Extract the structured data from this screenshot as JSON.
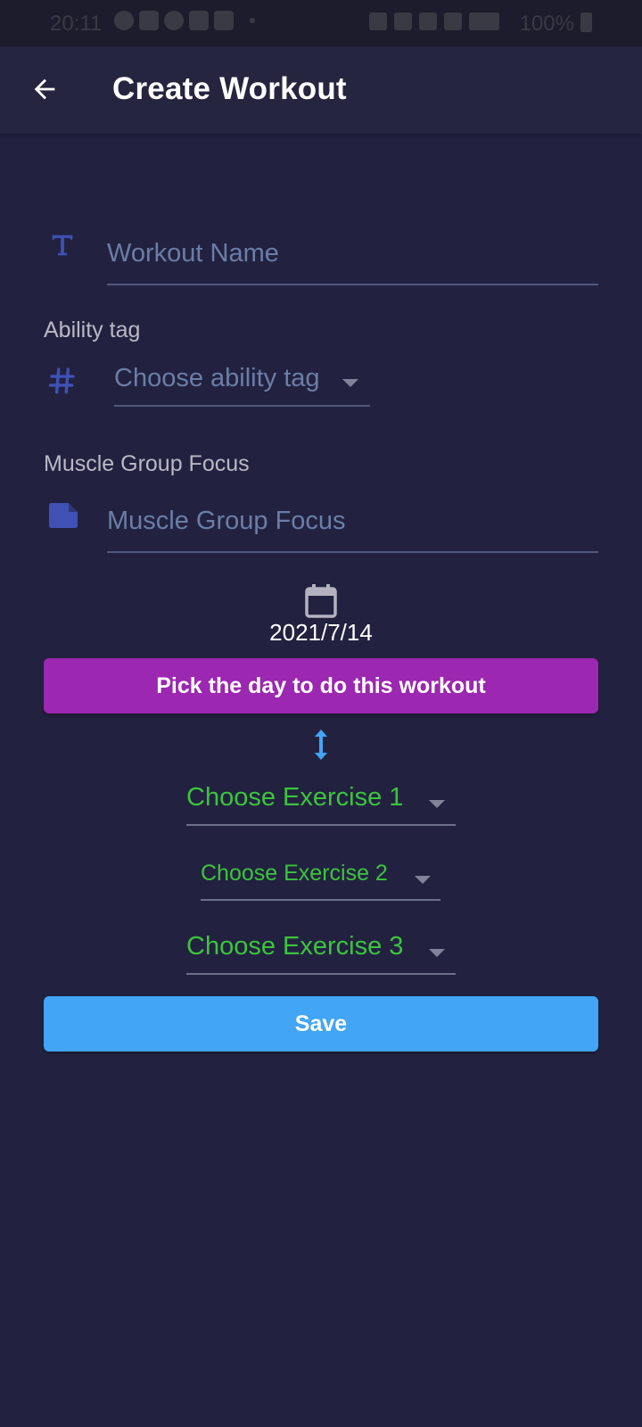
{
  "status_bar": {
    "time": "20:11",
    "battery": "100%"
  },
  "app_bar": {
    "title": "Create Workout"
  },
  "form": {
    "workout_name_placeholder": "Workout Name",
    "ability_tag_label": "Ability tag",
    "ability_tag_placeholder": "Choose ability tag",
    "muscle_group_label": "Muscle Group Focus",
    "muscle_group_placeholder": "Muscle Group Focus",
    "date": "2021/7/14",
    "pick_day_button": "Pick the day to do this workout",
    "exercise_dropdowns": [
      "Choose Exercise 1",
      "Choose Exercise 2",
      "Choose Exercise 3"
    ],
    "save_button": "Save"
  },
  "colors": {
    "background": "#222240",
    "app_bar": "#25253f",
    "accent_icon": "#3f51b5",
    "pick_button": "#9c27b0",
    "save_button": "#42a5f5",
    "exercise_text": "#3cc43c",
    "placeholder": "#6b7ea6"
  },
  "icons": {
    "back": "arrow-left-icon",
    "workout_name": "text-fields-icon",
    "ability_tag": "hashtag-icon",
    "muscle_group": "note-icon",
    "date": "calendar-icon",
    "reorder": "swap-vertical-icon"
  }
}
